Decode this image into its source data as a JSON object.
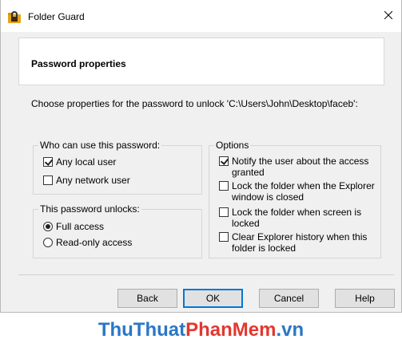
{
  "window": {
    "title": "Folder Guard",
    "close_glyph": "✕"
  },
  "header": {
    "title": "Password properties"
  },
  "instruction": "Choose properties for the password to unlock 'C:\\Users\\John\\Desktop\\faceb':",
  "who_group": {
    "label": "Who can use this password:",
    "items": [
      {
        "label": "Any local user",
        "checked": true
      },
      {
        "label": "Any network user",
        "checked": false
      }
    ]
  },
  "unlocks_group": {
    "label": "This password unlocks:",
    "items": [
      {
        "label": "Full access",
        "selected": true
      },
      {
        "label": "Read-only access",
        "selected": false
      }
    ]
  },
  "options_group": {
    "label": "Options",
    "items": [
      {
        "line1": "Notify the user about the access",
        "line2": "granted",
        "checked": true
      },
      {
        "line1": "Lock the folder when the Explorer",
        "line2": "window is closed",
        "checked": false
      },
      {
        "line1": "Lock the folder when screen is",
        "line2": "locked",
        "checked": false
      },
      {
        "line1": "Clear Explorer history when this",
        "line2": "folder is locked",
        "checked": false
      }
    ]
  },
  "buttons": {
    "back": "Back",
    "ok": "OK",
    "cancel": "Cancel",
    "help": "Help"
  },
  "watermark": {
    "part1": "ThuThuat",
    "part2": "PhanMem",
    "part3": ".vn"
  },
  "colors": {
    "accent": "#0078d7",
    "watermark_blue": "#2a77c6",
    "watermark_red": "#e2382f",
    "dialog_bg": "#f0f0f0"
  },
  "icons": {
    "app": "folder-guard-lock-icon",
    "close": "close-icon"
  }
}
